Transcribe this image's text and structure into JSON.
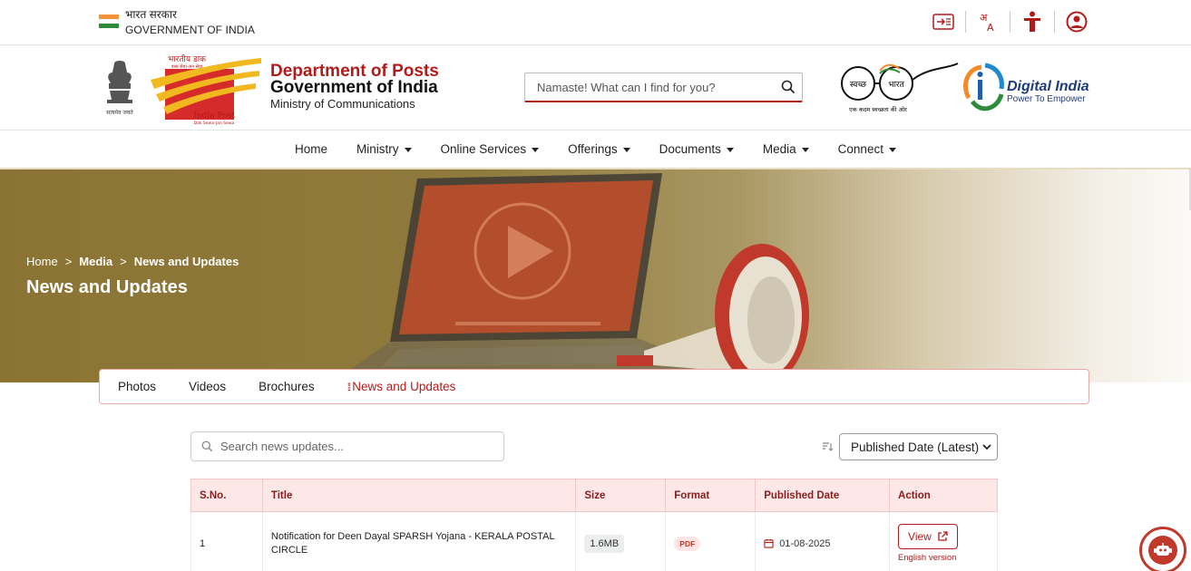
{
  "gov_strip": {
    "hindi": "भारत सरकार",
    "english": "GOVERNMENT OF INDIA",
    "icons": [
      "skip-to-content-icon",
      "language-icon",
      "accessibility-icon",
      "user-account-icon"
    ]
  },
  "branding": {
    "dept_title": "Department of Posts",
    "dept_gov": "Government of India",
    "ministry": "Ministry of Communications",
    "search_placeholder": "Namaste! What can I find for you?",
    "indiapost_hindi": "भारतीय डाक",
    "indiapost_tagline_hi": "डाक सेवा-जन सेवा",
    "indiapost_name": "India Post",
    "indiapost_tagline_en": "Dak Sewa-Jan Sewa",
    "emblem_caption": "सत्यमेव जयते",
    "swachh_left": "स्वच्छ",
    "swachh_right": "भारत",
    "swachh_caption": "एक कदम स्वच्छता की ओर",
    "digital_india": "Digital India",
    "digital_india_tag": "Power To Empower"
  },
  "nav": {
    "items": [
      {
        "label": "Home",
        "dropdown": false
      },
      {
        "label": "Ministry",
        "dropdown": true
      },
      {
        "label": "Online Services",
        "dropdown": true
      },
      {
        "label": "Offerings",
        "dropdown": true
      },
      {
        "label": "Documents",
        "dropdown": true
      },
      {
        "label": "Media",
        "dropdown": true
      },
      {
        "label": "Connect",
        "dropdown": true
      }
    ]
  },
  "hero": {
    "breadcrumb": [
      "Home",
      "Media",
      "News and Updates"
    ],
    "breadcrumb_sep": ">",
    "title": "News and Updates"
  },
  "tabs": {
    "items": [
      "Photos",
      "Videos",
      "Brochures",
      "News and Updates"
    ],
    "active_index": 3
  },
  "filters": {
    "search_placeholder": "Search news updates...",
    "sort_selected": "Published Date (Latest)"
  },
  "table": {
    "headers": [
      "S.No.",
      "Title",
      "Size",
      "Format",
      "Published Date",
      "Action"
    ],
    "rows": [
      {
        "sno": "1",
        "title": "Notification for Deen Dayal SPARSH Yojana - KERALA POSTAL CIRCLE",
        "size": "1.6MB",
        "format": "PDF",
        "date": "01-08-2025",
        "action_label": "View",
        "language": "English version"
      }
    ]
  },
  "colors": {
    "brand_red": "#b31b1b",
    "header_bg": "#fde7e7",
    "hero_olive": "#8b7433"
  }
}
